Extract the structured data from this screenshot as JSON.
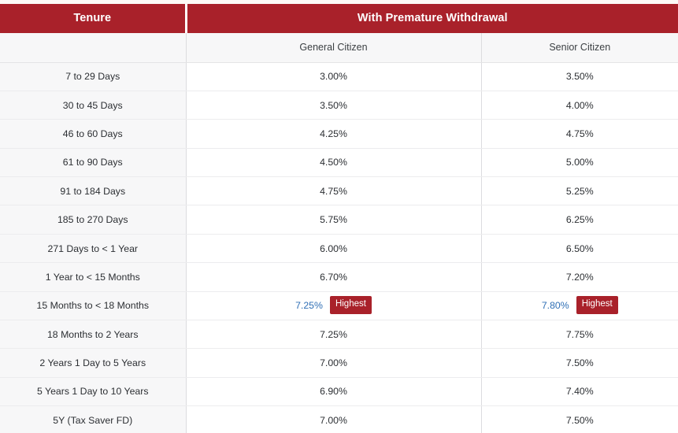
{
  "table": {
    "header": {
      "tenure_label": "Tenure",
      "group_label": "With Premature Withdrawal",
      "sub": {
        "blank": "",
        "general_label": "General Citizen",
        "senior_label": "Senior Citizen"
      }
    },
    "badge_label": "Highest",
    "colors": {
      "header_red": "#a9212a",
      "badge_red": "#a9212a",
      "highlight_text_blue": "#2f6fb5",
      "tenure_column_bg": "#f7f7f8",
      "row_border": "#ececee",
      "page_bg": "#fdfaf6"
    },
    "rows": [
      {
        "tenure": "7 to 29 Days",
        "general": "3.00%",
        "senior": "3.50%",
        "general_highest": false,
        "senior_highest": false
      },
      {
        "tenure": "30 to 45 Days",
        "general": "3.50%",
        "senior": "4.00%",
        "general_highest": false,
        "senior_highest": false
      },
      {
        "tenure": "46 to 60 Days",
        "general": "4.25%",
        "senior": "4.75%",
        "general_highest": false,
        "senior_highest": false
      },
      {
        "tenure": "61 to 90 Days",
        "general": "4.50%",
        "senior": "5.00%",
        "general_highest": false,
        "senior_highest": false
      },
      {
        "tenure": "91 to 184 Days",
        "general": "4.75%",
        "senior": "5.25%",
        "general_highest": false,
        "senior_highest": false
      },
      {
        "tenure": "185 to 270 Days",
        "general": "5.75%",
        "senior": "6.25%",
        "general_highest": false,
        "senior_highest": false
      },
      {
        "tenure": "271 Days to < 1 Year",
        "general": "6.00%",
        "senior": "6.50%",
        "general_highest": false,
        "senior_highest": false
      },
      {
        "tenure": "1 Year to < 15 Months",
        "general": "6.70%",
        "senior": "7.20%",
        "general_highest": false,
        "senior_highest": false
      },
      {
        "tenure": "15 Months to < 18 Months",
        "general": "7.25%",
        "senior": "7.80%",
        "general_highest": true,
        "senior_highest": true
      },
      {
        "tenure": "18 Months to 2 Years",
        "general": "7.25%",
        "senior": "7.75%",
        "general_highest": false,
        "senior_highest": false
      },
      {
        "tenure": "2 Years 1 Day to 5 Years",
        "general": "7.00%",
        "senior": "7.50%",
        "general_highest": false,
        "senior_highest": false
      },
      {
        "tenure": "5 Years 1 Day to 10 Years",
        "general": "6.90%",
        "senior": "7.40%",
        "general_highest": false,
        "senior_highest": false
      },
      {
        "tenure": "5Y (Tax Saver FD)",
        "general": "7.00%",
        "senior": "7.50%",
        "general_highest": false,
        "senior_highest": false
      }
    ]
  }
}
